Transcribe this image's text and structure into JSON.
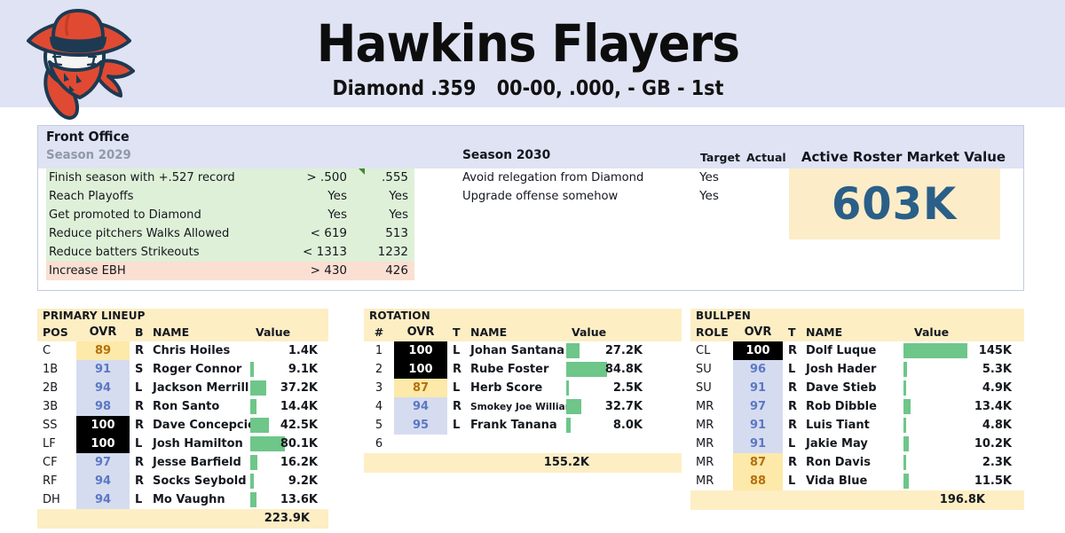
{
  "header": {
    "team_name": "Hawkins Flayers",
    "league": "Diamond .359",
    "record": "00-00, .000, - GB - 1st",
    "logo_icon": "cowboy-baseball-logo",
    "band_color": "#dfe3f3"
  },
  "front_office": {
    "title": "Front Office",
    "season_2029_label": "Season 2029",
    "goals_2029": [
      {
        "name": "Finish season with +.527 record",
        "target": "> .500",
        "actual": ".555",
        "met": true,
        "flag": true
      },
      {
        "name": "Reach Playoffs",
        "target": "Yes",
        "actual": "Yes",
        "met": true,
        "flag": false
      },
      {
        "name": "Get promoted to Diamond",
        "target": "Yes",
        "actual": "Yes",
        "met": true,
        "flag": false
      },
      {
        "name": "Reduce pitchers Walks Allowed",
        "target": "< 619",
        "actual": "513",
        "met": true,
        "flag": false
      },
      {
        "name": "Reduce batters Strikeouts",
        "target": "< 1313",
        "actual": "1232",
        "met": true,
        "flag": false
      },
      {
        "name": "Increase EBH",
        "target": "> 430",
        "actual": "426",
        "met": false,
        "flag": false
      }
    ],
    "season_2030_label": "Season 2030",
    "col_target": "Target",
    "col_actual": "Actual",
    "goals_2030": [
      {
        "name": "Avoid relegation from Diamond",
        "target": "Yes",
        "actual": ""
      },
      {
        "name": "Upgrade offense somehow",
        "target": "Yes",
        "actual": ""
      }
    ],
    "market_value_label": "Active Roster Market Value",
    "market_value": "603K",
    "market_value_color": "#2a5f88"
  },
  "lineup": {
    "caption": "PRIMARY LINEUP",
    "columns": {
      "pos": "POS",
      "ovr": "OVR",
      "hand": "B",
      "name": "NAME",
      "value": "Value"
    },
    "rows": [
      {
        "pos": "C",
        "ovr": "89",
        "tier": "lo",
        "hand": "R",
        "name": "Chris Hoiles",
        "value": "1.4K",
        "bar": 0
      },
      {
        "pos": "1B",
        "ovr": "91",
        "tier": "mid",
        "hand": "S",
        "name": "Roger Connor",
        "value": "9.1K",
        "bar": 5
      },
      {
        "pos": "2B",
        "ovr": "94",
        "tier": "mid",
        "hand": "L",
        "name": "Jackson Merrill",
        "value": "37.2K",
        "bar": 22
      },
      {
        "pos": "3B",
        "ovr": "98",
        "tier": "mid",
        "hand": "R",
        "name": "Ron Santo",
        "value": "14.4K",
        "bar": 8
      },
      {
        "pos": "SS",
        "ovr": "100",
        "tier": "max",
        "hand": "R",
        "name": "Dave Concepcion",
        "value": "42.5K",
        "bar": 25
      },
      {
        "pos": "LF",
        "ovr": "100",
        "tier": "max",
        "hand": "L",
        "name": "Josh Hamilton",
        "value": "80.1K",
        "bar": 47
      },
      {
        "pos": "CF",
        "ovr": "97",
        "tier": "mid",
        "hand": "R",
        "name": "Jesse Barfield",
        "value": "16.2K",
        "bar": 10
      },
      {
        "pos": "RF",
        "ovr": "94",
        "tier": "mid",
        "hand": "R",
        "name": "Socks Seybold",
        "value": "9.2K",
        "bar": 5
      },
      {
        "pos": "DH",
        "ovr": "94",
        "tier": "mid",
        "hand": "L",
        "name": "Mo Vaughn",
        "value": "13.6K",
        "bar": 8
      }
    ],
    "total": "223.9K"
  },
  "rotation": {
    "caption": "ROTATION",
    "columns": {
      "pos": "#",
      "ovr": "OVR",
      "hand": "T",
      "name": "NAME",
      "value": "Value"
    },
    "rows": [
      {
        "pos": "1",
        "ovr": "100",
        "tier": "max",
        "hand": "L",
        "name": "Johan Santana",
        "value": "27.2K",
        "bar": 16,
        "small": false
      },
      {
        "pos": "2",
        "ovr": "100",
        "tier": "max",
        "hand": "R",
        "name": "Rube Foster",
        "value": "84.8K",
        "bar": 50,
        "small": false
      },
      {
        "pos": "3",
        "ovr": "87",
        "tier": "lo",
        "hand": "L",
        "name": "Herb Score",
        "value": "2.5K",
        "bar": 2,
        "small": false
      },
      {
        "pos": "4",
        "ovr": "94",
        "tier": "mid",
        "hand": "R",
        "name": "Smokey Joe Williams",
        "value": "32.7K",
        "bar": 19,
        "small": true
      },
      {
        "pos": "5",
        "ovr": "95",
        "tier": "mid",
        "hand": "L",
        "name": "Frank Tanana",
        "value": "8.0K",
        "bar": 5,
        "small": false
      },
      {
        "pos": "6",
        "ovr": "",
        "tier": "none",
        "hand": "",
        "name": "",
        "value": "",
        "bar": 0,
        "small": false
      }
    ],
    "total": "155.2K"
  },
  "bullpen": {
    "caption": "BULLPEN",
    "columns": {
      "pos": "ROLE",
      "ovr": "OVR",
      "hand": "T",
      "name": "NAME",
      "value": "Value"
    },
    "rows": [
      {
        "pos": "CL",
        "ovr": "100",
        "tier": "max",
        "hand": "R",
        "name": "Dolf Luque",
        "value": "145K",
        "bar": 56
      },
      {
        "pos": "SU",
        "ovr": "96",
        "tier": "mid",
        "hand": "L",
        "name": "Josh Hader",
        "value": "5.3K",
        "bar": 3
      },
      {
        "pos": "SU",
        "ovr": "91",
        "tier": "mid",
        "hand": "R",
        "name": "Dave Stieb",
        "value": "4.9K",
        "bar": 2
      },
      {
        "pos": "MR",
        "ovr": "97",
        "tier": "mid",
        "hand": "R",
        "name": "Rob Dibble",
        "value": "13.4K",
        "bar": 6
      },
      {
        "pos": "MR",
        "ovr": "91",
        "tier": "mid",
        "hand": "R",
        "name": "Luis Tiant",
        "value": "4.8K",
        "bar": 2
      },
      {
        "pos": "MR",
        "ovr": "91",
        "tier": "mid",
        "hand": "L",
        "name": "Jakie May",
        "value": "10.2K",
        "bar": 5
      },
      {
        "pos": "MR",
        "ovr": "87",
        "tier": "lo",
        "hand": "R",
        "name": "Ron Davis",
        "value": "2.3K",
        "bar": 2
      },
      {
        "pos": "MR",
        "ovr": "88",
        "tier": "lo",
        "hand": "L",
        "name": "Vida Blue",
        "value": "11.5K",
        "bar": 5
      }
    ],
    "total": "196.8K"
  },
  "colors": {
    "cream": "#fdeec4",
    "green_bar": "#6ec689",
    "goal_met": "#dff0d8",
    "goal_missed": "#fbdfd2",
    "ovr_low": "#fde9a9",
    "ovr_mid": "#d5dcf0",
    "ovr_max": "#000000"
  }
}
